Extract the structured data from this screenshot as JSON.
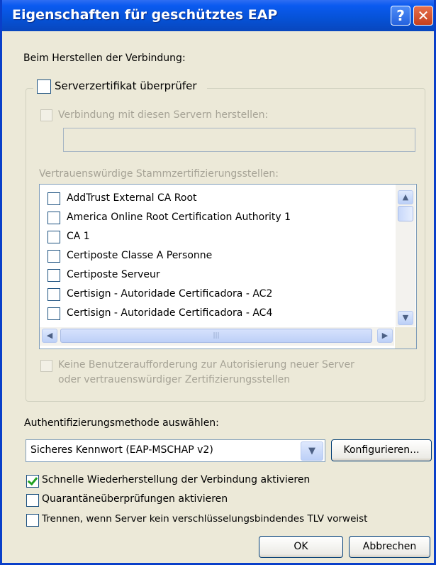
{
  "window": {
    "title": "Eigenschaften für geschütztes EAP",
    "help_glyph": "?",
    "close_glyph": "✕"
  },
  "connection": {
    "heading": "Beim Herstellen der Verbindung:",
    "validate_cert": {
      "label": "Serverzertifikat überprüfer",
      "checked": false
    },
    "connect_servers": {
      "label": "Verbindung mit diesen Servern herstellen:",
      "checked": false,
      "enabled": false,
      "value": ""
    },
    "trusted_ca_label": "Vertrauenswürdige Stammzertifizierungsstellen:",
    "ca_list": [
      {
        "label": "AddTrust External CA Root",
        "checked": false
      },
      {
        "label": "America Online Root Certification Authority 1",
        "checked": false
      },
      {
        "label": "CA 1",
        "checked": false
      },
      {
        "label": "Certiposte Classe A Personne",
        "checked": false
      },
      {
        "label": "Certiposte Serveur",
        "checked": false
      },
      {
        "label": "Certisign - Autoridade Certificadora - AC2",
        "checked": false
      },
      {
        "label": "Certisign - Autoridade Certificadora - AC4",
        "checked": false
      }
    ],
    "scroll_icons": {
      "up": "▲",
      "down": "▼",
      "left": "◀",
      "right": "▶",
      "grip": "|||"
    },
    "no_prompt": {
      "line1": "Keine Benutzeraufforderung zur Autorisierung neuer Server",
      "line2": "oder vertrauenswürdiger Zertifizierungsstellen",
      "checked": false,
      "enabled": false
    }
  },
  "auth": {
    "heading": "Authentifizierungsmethode auswählen:",
    "selected": "Sicheres Kennwort (EAP-MSCHAP v2)",
    "dropdown_glyph": "▼",
    "configure_label": "Konfigurieren..."
  },
  "options": [
    {
      "label": "Schnelle Wiederherstellung der Verbindung aktivieren",
      "checked": true
    },
    {
      "label": "Quarantäneüberprüfungen aktivieren",
      "checked": false
    },
    {
      "label": "Trennen, wenn Server kein verschlüsselungsbindendes TLV vorweist",
      "checked": false
    }
  ],
  "buttons": {
    "ok": "OK",
    "cancel": "Abbrechen"
  },
  "colors": {
    "titlebar": "#0652d6",
    "dialog_bg": "#ece9d8",
    "check_green": "#21a121"
  }
}
